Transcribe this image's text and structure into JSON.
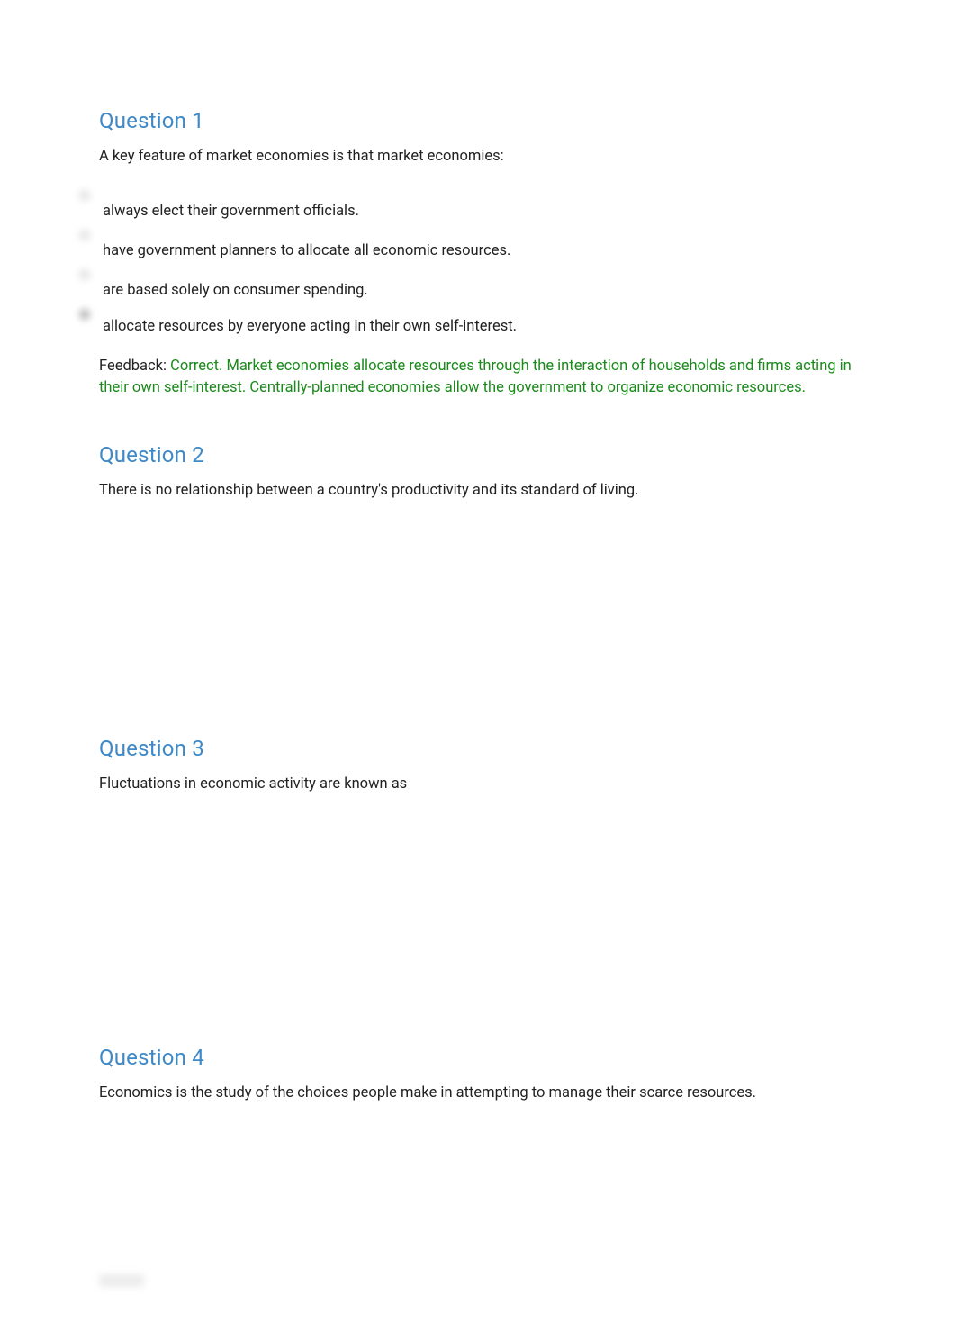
{
  "questions": [
    {
      "title": "Question 1",
      "prompt": "A key feature of market economies is that market economies:",
      "options": [
        "always elect their government officials.",
        "have government planners to allocate all economic resources.",
        "are based solely on consumer spending.",
        "allocate resources by everyone acting in their own self-interest."
      ],
      "feedback_label": "Feedback: ",
      "feedback_text": "Correct. Market economies allocate resources through the interaction of households and firms acting in their own self-interest. Centrally-planned economies allow the government to organize economic resources."
    },
    {
      "title": "Question 2",
      "prompt": "There is no relationship between a country's productivity and its standard of living."
    },
    {
      "title": "Question 3",
      "prompt": "Fluctuations in economic activity are known as"
    },
    {
      "title": "Question 4",
      "prompt": "Economics is the study of the choices people make in attempting to manage their scarce resources."
    }
  ]
}
